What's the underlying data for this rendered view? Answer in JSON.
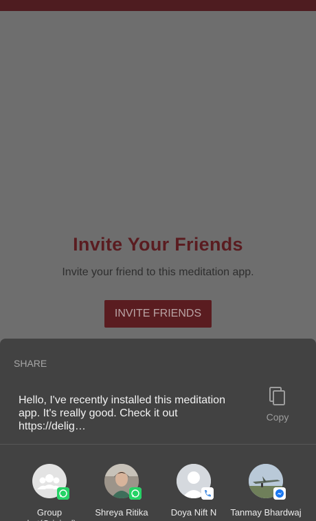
{
  "app": {
    "title": "Invite Your Friends",
    "subtitle": "Invite your friend to this meditation app.",
    "button_label": "INVITE FRIENDS"
  },
  "share_sheet": {
    "header": "SHARE",
    "message": "Hello, I've recently installed this meditation app. It's really good. Check it out https://delig…",
    "copy_label": "Copy",
    "targets": [
      {
        "name": "Group chat(Original)",
        "app": "whatsapp",
        "icon": "group-icon"
      },
      {
        "name": "Shreya Ritika",
        "app": "whatsapp",
        "icon": "avatar-photo"
      },
      {
        "name": "Doya Nift N",
        "app": "phone",
        "icon": "person-icon"
      },
      {
        "name": "Tanmay Bhardwaj",
        "app": "messenger",
        "icon": "avatar-photo"
      }
    ]
  },
  "colors": {
    "brand": "#5a1c20",
    "sheet_bg": "#424242",
    "whatsapp": "#25d366",
    "messenger": "#1877f2"
  }
}
